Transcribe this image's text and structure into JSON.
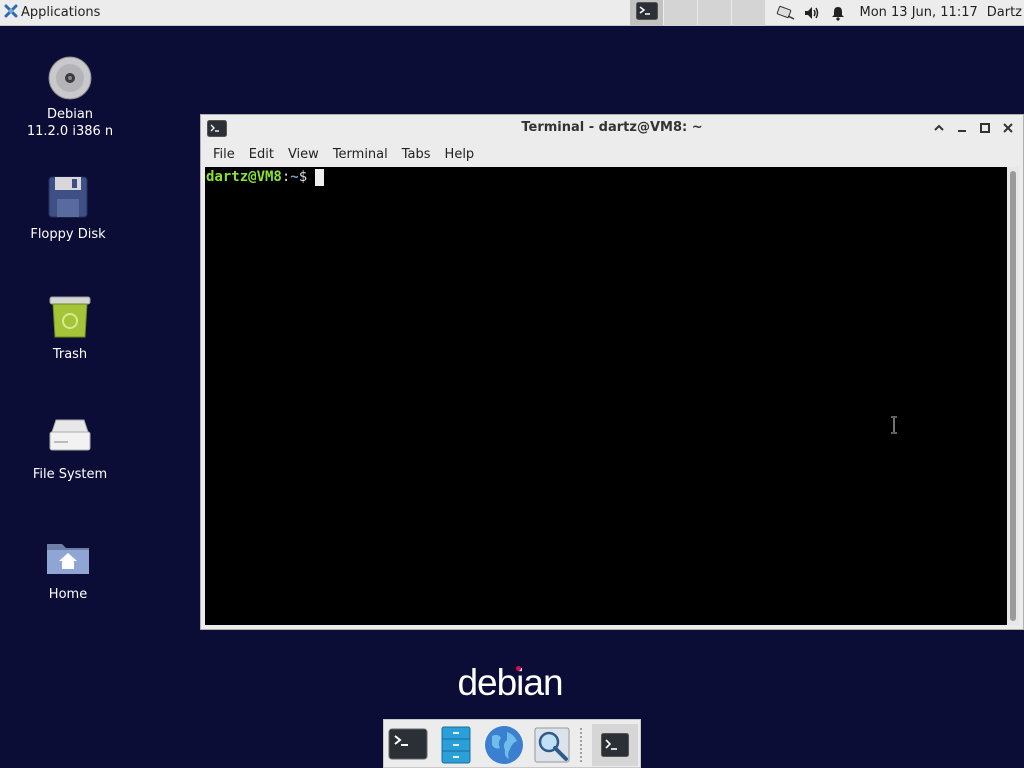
{
  "top_panel": {
    "applications_label": "Applications",
    "clock": "Mon 13 Jun, 11:17",
    "user": "Dartz",
    "tray_icons": [
      "network-icon",
      "volume-icon",
      "notifications-icon"
    ]
  },
  "desktop": {
    "icons": [
      {
        "label_line1": "Debian",
        "label_line2": "11.2.0 i386 n",
        "icon": "cd-icon"
      },
      {
        "label": "Floppy Disk",
        "icon": "floppy-icon"
      },
      {
        "label": "Trash",
        "icon": "trash-icon"
      },
      {
        "label": "File System",
        "icon": "drive-icon"
      },
      {
        "label": "Home",
        "icon": "home-folder-icon"
      }
    ]
  },
  "terminal": {
    "title": "Terminal - dartz@VM8: ~",
    "menu": [
      "File",
      "Edit",
      "View",
      "Terminal",
      "Tabs",
      "Help"
    ],
    "prompt": {
      "user_host": "dartz@VM8",
      "colon": ":",
      "path": "~",
      "dollar": "$"
    }
  },
  "branding": {
    "logo_text": "debian"
  },
  "dock": {
    "items": [
      "terminal-icon",
      "file-manager-icon",
      "web-browser-icon",
      "app-finder-icon",
      "terminal-window-icon"
    ]
  },
  "colors": {
    "desktop_background": "#0b0d37",
    "prompt_user": "#8ae234",
    "prompt_path": "#729fcf",
    "debian_red": "#d70751"
  }
}
